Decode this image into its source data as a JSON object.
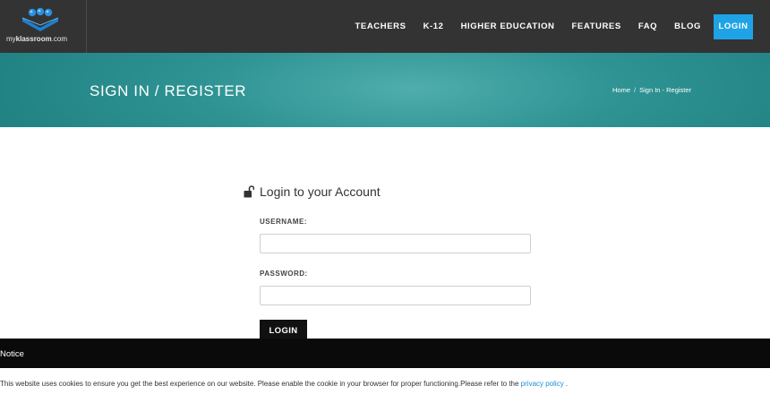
{
  "header": {
    "logo_text_prefix": "my",
    "logo_text_bold": "klassroom",
    "logo_text_suffix": ".com",
    "nav": [
      {
        "label": "TEACHERS"
      },
      {
        "label": "K-12"
      },
      {
        "label": "HIGHER EDUCATION"
      },
      {
        "label": "FEATURES"
      },
      {
        "label": "FAQ"
      },
      {
        "label": "BLOG"
      }
    ],
    "login_label": "LOGIN"
  },
  "banner": {
    "title": "SIGN IN / REGISTER",
    "breadcrumb_home": "Home",
    "breadcrumb_sep": "/",
    "breadcrumb_current": "Sign In - Register"
  },
  "login": {
    "title": "Login to your Account",
    "username_label": "USERNAME:",
    "username_value": "",
    "password_label": "PASSWORD:",
    "password_value": "",
    "submit_label": "LOGIN"
  },
  "notice": {
    "title": "Notice",
    "text": "This website uses cookies to ensure you get the best experience on our website. Please enable the cookie in your browser for proper functioning.Please refer to the ",
    "link": "privacy policy",
    "text_end": " ."
  },
  "colors": {
    "header_bg": "#333333",
    "accent": "#1ea3e6",
    "banner": "#2f9393",
    "notice_bg": "#0a0a0a"
  },
  "icons": [
    "logo-icon",
    "lock-open-icon"
  ]
}
